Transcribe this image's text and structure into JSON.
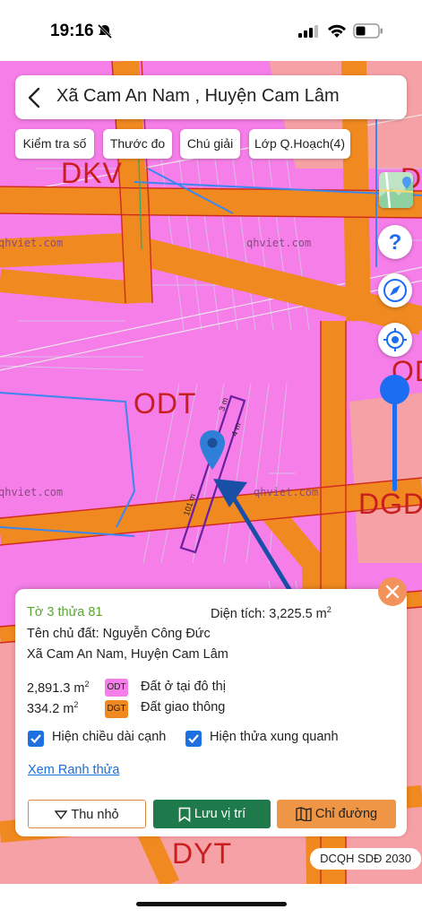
{
  "status_bar": {
    "time": "19:16"
  },
  "search": {
    "title": "Xã Cam An Nam , Huyện Cam Lâm"
  },
  "chips": [
    {
      "label": "Kiểm tra số"
    },
    {
      "label": "Thước đo"
    },
    {
      "label": "Chú giải"
    },
    {
      "label": "Lớp Q.Hoạch(4)"
    }
  ],
  "map": {
    "zones": {
      "dkv": "DKV",
      "odt": "ODT",
      "od_right": "OD",
      "dgd": "DGD",
      "dyt": "DYT",
      "d_right": "D"
    },
    "watermark": "qhviet.com",
    "measure_a": "101 m",
    "measure_b": "3 m",
    "measure_c": "4 m",
    "badge": "DCQH SDĐ 2030"
  },
  "colors": {
    "residential": "#f57ee8",
    "road": "#f0891f",
    "highlight": "#6b1fa0",
    "accent": "#1d6df2"
  },
  "panel": {
    "parcel": "Tờ 3 thửa 81",
    "area_label": "Diện tích: 3,225.5 m",
    "area_sup": "2",
    "owner": "Tên chủ đất: Nguyễn Công Đức",
    "address": "Xã Cam An Nam, Huyện Cam Lâm",
    "rows": [
      {
        "area": "2,891.3 m",
        "sup": "2",
        "code": "ODT",
        "desc": "Đất ở tại đô thị"
      },
      {
        "area": "334.2 m",
        "sup": "2",
        "code": "DGT",
        "desc": "Đất giao thông"
      }
    ],
    "cb_edges": "Hiện chiều dài cạnh",
    "cb_neighbors": "Hiện thửa xung quanh",
    "boundary_link": "Xem Ranh thửa",
    "btn_zoom": "Thu nhỏ",
    "btn_save": "Lưu vị trí",
    "btn_route": "Chỉ đường"
  }
}
